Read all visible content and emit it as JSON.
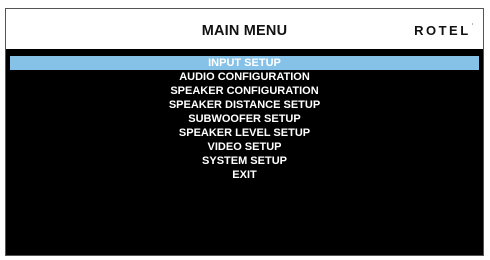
{
  "header": {
    "title": "MAIN MENU",
    "logo": "ROTEL"
  },
  "menu": {
    "items": [
      {
        "label": "INPUT SETUP",
        "selected": true
      },
      {
        "label": "AUDIO CONFIGURATION",
        "selected": false
      },
      {
        "label": "SPEAKER CONFIGURATION",
        "selected": false
      },
      {
        "label": "SPEAKER DISTANCE SETUP",
        "selected": false
      },
      {
        "label": "SUBWOOFER SETUP",
        "selected": false
      },
      {
        "label": "SPEAKER LEVEL SETUP",
        "selected": false
      },
      {
        "label": "VIDEO SETUP",
        "selected": false
      },
      {
        "label": "SYSTEM SETUP",
        "selected": false
      },
      {
        "label": "EXIT",
        "selected": false
      }
    ]
  },
  "colors": {
    "screen_background": "#000000",
    "header_background": "#ffffff",
    "selection_highlight": "#86c1e8",
    "menu_text": "#ffffff"
  },
  "icons": {
    "logo_mark": "registered-mark-icon"
  }
}
